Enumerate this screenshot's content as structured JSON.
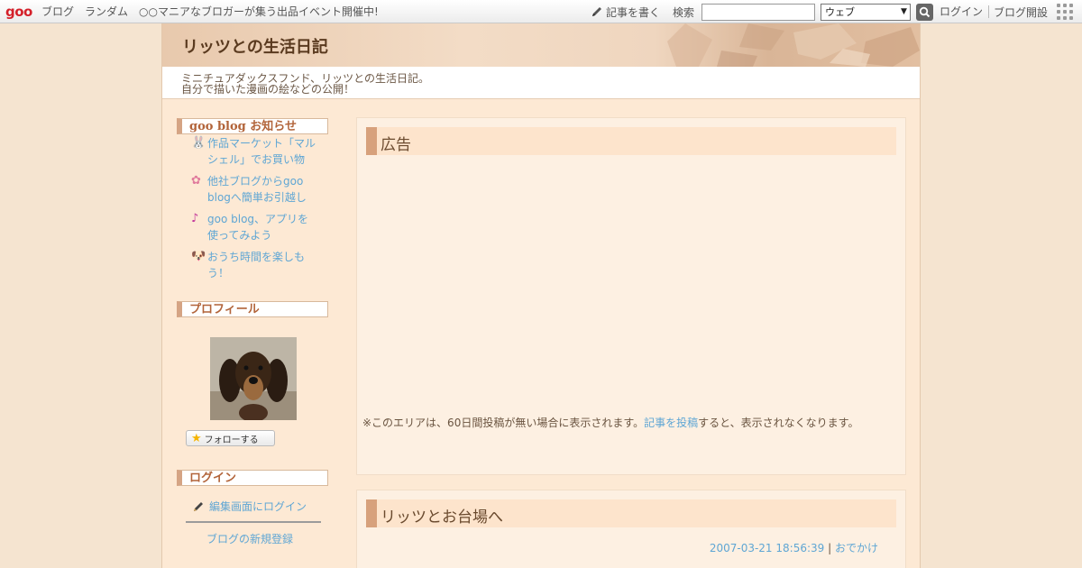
{
  "topbar": {
    "logo": "goo",
    "links": [
      "ブログ",
      "ランダム",
      "○○マニアなブロガーが集う出品イベント開催中!"
    ],
    "write_label": "記事を書く",
    "search_label": "検索",
    "search_value": "",
    "search_scope": "ウェブ",
    "login": "ログイン",
    "open_blog": "ブログ開設"
  },
  "header": {
    "title": "リッツとの生活日記",
    "description_line1": "ミニチュアダックスフンド、リッツとの生活日記。",
    "description_line2": "自分で描いた漫画の絵などの公開！"
  },
  "sidebar": {
    "notice_heading": "goo blog お知らせ",
    "notices": [
      {
        "icon": "rabbit-icon",
        "glyph": "🐰",
        "label": "作品マーケット「マルシェル」でお買い物"
      },
      {
        "icon": "flower-icon",
        "glyph": "✿",
        "label": "他社ブログからgoo blogへ簡単お引越し"
      },
      {
        "icon": "music-note-icon",
        "glyph": "♪",
        "label": "goo blog、アプリを使ってみよう"
      },
      {
        "icon": "dog-icon",
        "glyph": "🐶",
        "label": "おうち時間を楽しもう！"
      }
    ],
    "profile_heading": "プロフィール",
    "follow_label": "フォローする",
    "login_heading": "ログイン",
    "edit_login": "編集画面にログイン",
    "register": "ブログの新規登録"
  },
  "ad_panel": {
    "heading": "広告",
    "note_prefix": "※このエリアは、60日間投稿が無い場合に表示されます。",
    "note_link": "記事を投稿",
    "note_suffix": "すると、表示されなくなります。"
  },
  "post": {
    "title": "リッツとお台場へ",
    "datetime": "2007-03-21 18:56:39",
    "separator": "|",
    "category": "おでかけ"
  },
  "colors": {
    "page_bg": "#f5e4d0",
    "link": "#5fa6d4",
    "heading_accent": "#d7a17c",
    "logo_red": "#d4202a"
  }
}
